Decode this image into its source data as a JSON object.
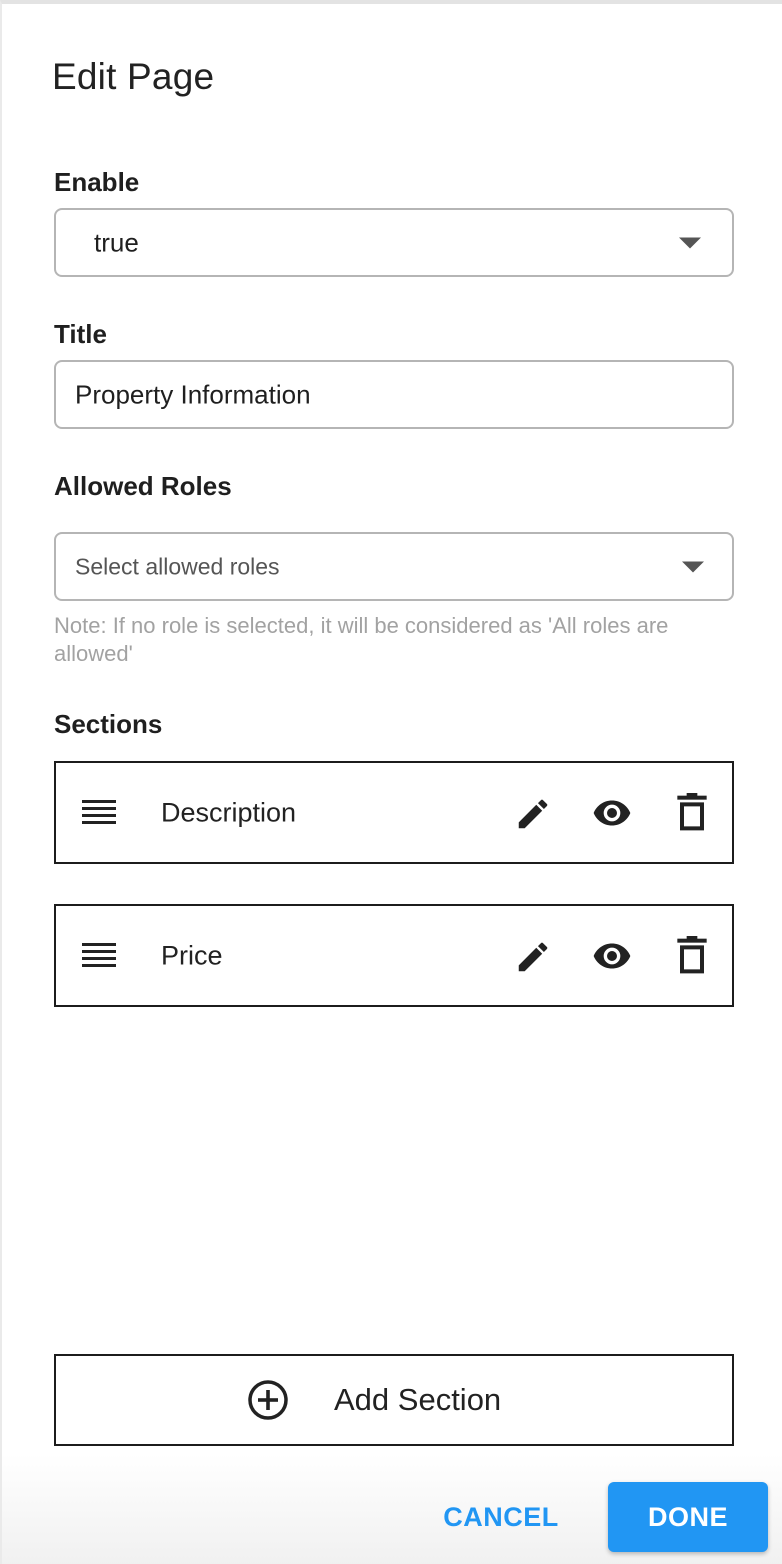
{
  "dialog": {
    "title": "Edit Page"
  },
  "enable": {
    "label": "Enable",
    "value": "true",
    "icon": "caret-down-icon"
  },
  "title_field": {
    "label": "Title",
    "value": "Property Information"
  },
  "allowed_roles": {
    "label": "Allowed Roles",
    "placeholder": "Select allowed roles",
    "note": "Note: If no role is selected, it will be considered as 'All roles are allowed'",
    "icon": "caret-down-icon"
  },
  "sections": {
    "label": "Sections",
    "items": [
      {
        "name": "Description",
        "icons": [
          "drag-handle-icon",
          "edit-icon",
          "eye-icon",
          "delete-icon"
        ]
      },
      {
        "name": "Price",
        "icons": [
          "drag-handle-icon",
          "edit-icon",
          "eye-icon",
          "delete-icon"
        ]
      }
    ]
  },
  "add_section": {
    "label": "Add Section",
    "icon": "add-circle-icon"
  },
  "actions": {
    "cancel_label": "CANCEL",
    "done_label": "DONE"
  },
  "colors": {
    "accent": "#2196f3",
    "border": "#b5b5b5",
    "note_text": "#a2a2a2"
  }
}
